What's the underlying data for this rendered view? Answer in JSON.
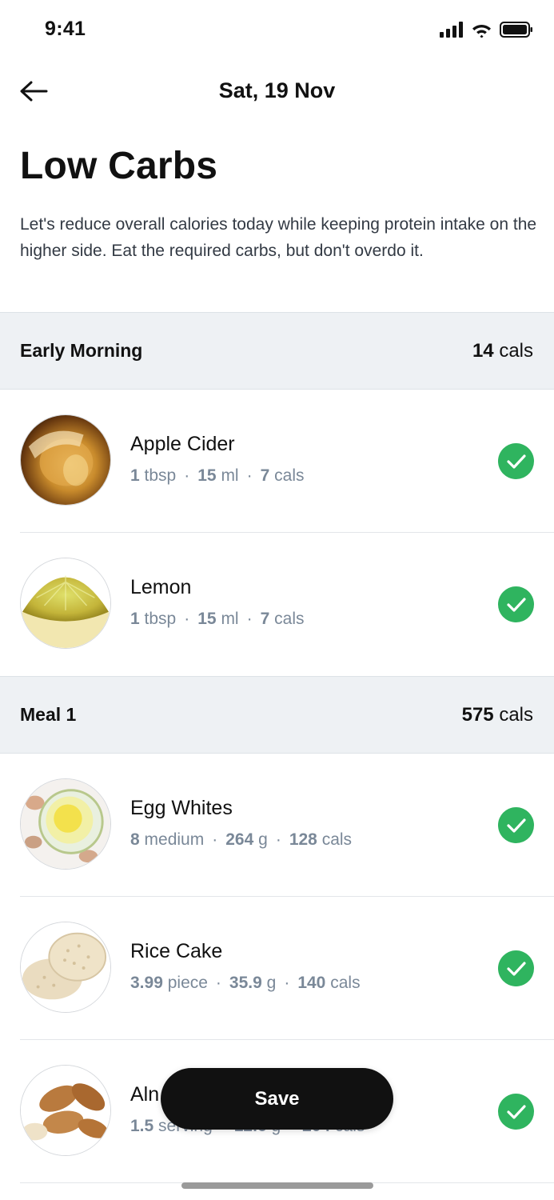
{
  "status_bar": {
    "time": "9:41"
  },
  "header": {
    "title": "Sat, 19 Nov"
  },
  "plan": {
    "title": "Low Carbs",
    "description": "Let's reduce overall calories today while keeping protein intake on the higher side. Eat the required carbs, but don't overdo it."
  },
  "sections": [
    {
      "name": "Early Morning",
      "cals_value": "14",
      "cals_unit": "cals",
      "items": [
        {
          "name": "Apple Cider",
          "qty_num": "1",
          "qty_unit": "tbsp",
          "weight_num": "15",
          "weight_unit": "ml",
          "cals_num": "7",
          "cals_unit": "cals",
          "checked": true,
          "icon": "apple-cider-photo"
        },
        {
          "name": "Lemon",
          "qty_num": "1",
          "qty_unit": "tbsp",
          "weight_num": "15",
          "weight_unit": "ml",
          "cals_num": "7",
          "cals_unit": "cals",
          "checked": true,
          "icon": "lemon-photo"
        }
      ]
    },
    {
      "name": "Meal 1",
      "cals_value": "575",
      "cals_unit": "cals",
      "items": [
        {
          "name": "Egg Whites",
          "qty_num": "8",
          "qty_unit": "medium",
          "weight_num": "264",
          "weight_unit": "g",
          "cals_num": "128",
          "cals_unit": "cals",
          "checked": true,
          "icon": "egg-whites-photo"
        },
        {
          "name": "Rice Cake",
          "qty_num": "3.99",
          "qty_unit": "piece",
          "weight_num": "35.9",
          "weight_unit": "g",
          "cals_num": "140",
          "cals_unit": "cals",
          "checked": true,
          "icon": "rice-cake-photo"
        },
        {
          "name": "Aln",
          "qty_num": "1.5",
          "qty_unit": "serving",
          "weight_num": "12.6",
          "weight_unit": "g",
          "cals_num": "204",
          "cals_unit": "cals",
          "checked": true,
          "icon": "almonds-photo"
        }
      ]
    }
  ],
  "actions": {
    "save_label": "Save"
  },
  "colors": {
    "check": "#2fb45f",
    "section_bg": "#eef1f4",
    "meta_text": "#7a8898",
    "save_bg": "#111111"
  }
}
